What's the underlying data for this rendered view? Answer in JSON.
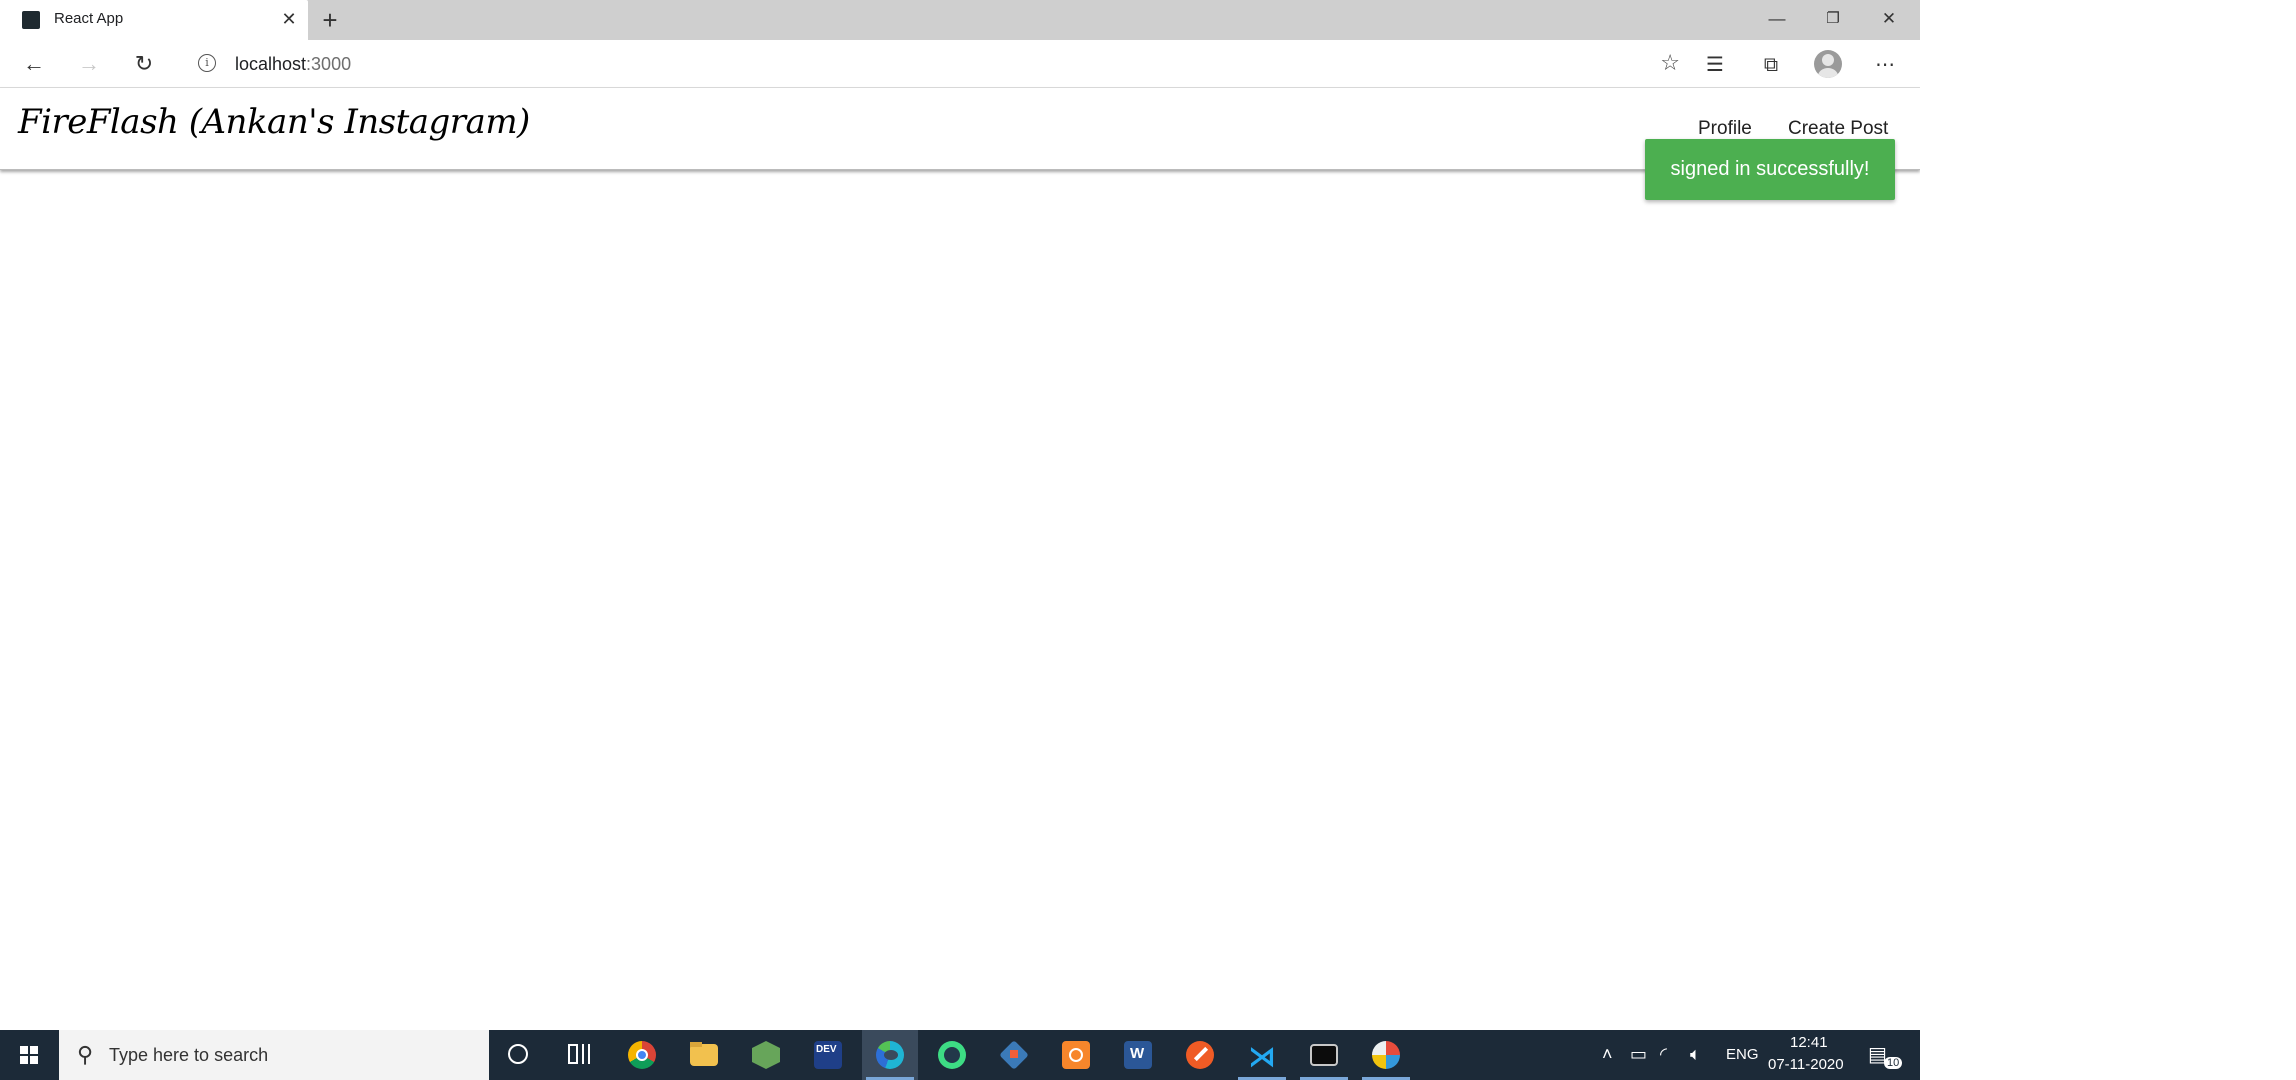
{
  "browser": {
    "tab_title": "React App",
    "tab_close": "✕",
    "new_tab": "+",
    "url_host": "localhost",
    "url_port": ":3000",
    "window_controls": {
      "minimize": "—",
      "maximize": "❐",
      "close": "✕"
    }
  },
  "app": {
    "brand": "FireFlash (Ankan's Instagram)",
    "menu": [
      {
        "label": "Profile"
      },
      {
        "label": "Create Post"
      }
    ],
    "toast": "signed in successfully!",
    "toast_color": "#4caf50"
  },
  "taskbar": {
    "search_placeholder": "Type here to search",
    "language": "ENG",
    "time": "12:41",
    "date": "07-11-2020",
    "notification_count": "10"
  }
}
